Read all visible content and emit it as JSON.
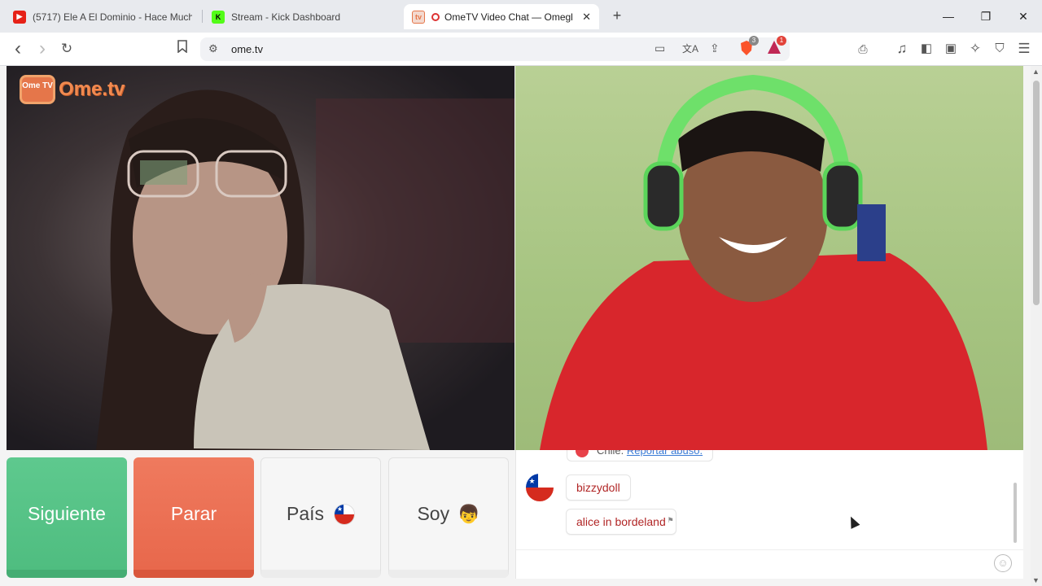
{
  "tabs": [
    {
      "title": "(5717) Ele A El Dominio - Hace Much",
      "favicon": "youtube-icon",
      "active": false
    },
    {
      "title": "Stream - Kick Dashboard",
      "favicon": "kick-icon",
      "active": false
    },
    {
      "title": "OmeTV Video Chat — Omegl",
      "favicon": "ometv-icon",
      "active": true
    }
  ],
  "tab_close": "✕",
  "new_tab": "+",
  "window_controls": {
    "minimize": "—",
    "restore": "❐",
    "close": "✕"
  },
  "toolbar": {
    "back": "‹",
    "forward": "›",
    "reload": "↻",
    "bookmark": "🔖",
    "url": "ome.tv",
    "translate_icon": "文A",
    "shields_badge": "3",
    "rewards_badge": "1"
  },
  "site": {
    "logo_tv": "Ome TV",
    "logo_brand": "Ome.tv"
  },
  "controls": {
    "next": "Siguiente",
    "stop": "Parar",
    "country": "País",
    "gender": "Soy"
  },
  "chat": {
    "cut_prefix": "Chile.",
    "cut_link": "Reportar abuso.",
    "messages": [
      "bizzydoll",
      "alice in bordeland"
    ],
    "emoji_button": "☺"
  },
  "colors": {
    "next": "#52c184",
    "stop": "#eb6f52",
    "message_text": "#b12626",
    "logo": "#f08a50"
  }
}
